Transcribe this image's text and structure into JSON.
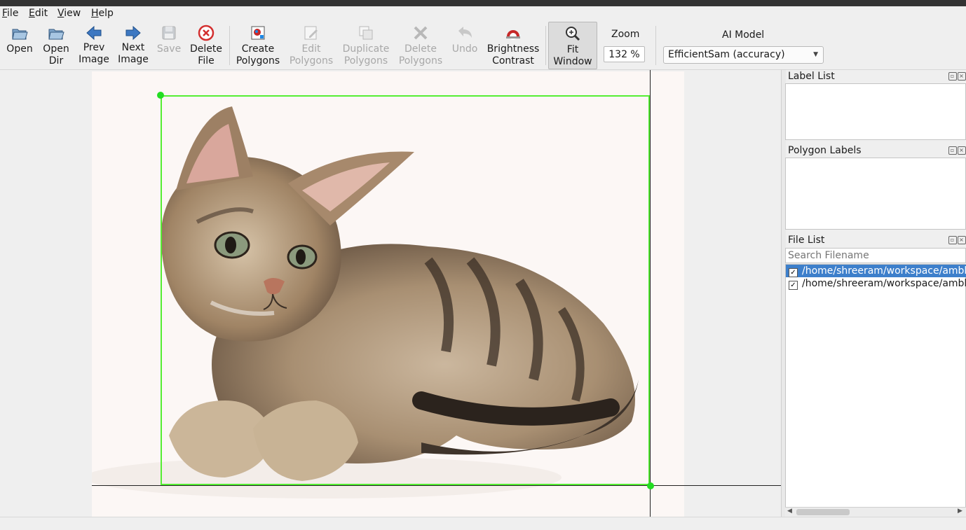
{
  "menu": [
    {
      "label": "File"
    },
    {
      "label": "Edit"
    },
    {
      "label": "View"
    },
    {
      "label": "Help"
    }
  ],
  "toolbar": {
    "open": "Open",
    "open_dir": "Open\nDir",
    "prev_image": "Prev\nImage",
    "next_image": "Next\nImage",
    "save": "Save",
    "delete_file": "Delete\nFile",
    "create_polygons": "Create\nPolygons",
    "edit_polygons": "Edit\nPolygons",
    "duplicate_polygons": "Duplicate\nPolygons",
    "delete_polygons": "Delete\nPolygons",
    "undo": "Undo",
    "brightness_contrast": "Brightness\nContrast",
    "fit_window": "Fit\nWindow"
  },
  "zoom": {
    "label": "Zoom",
    "value": "132 %"
  },
  "ai_model": {
    "label": "AI Model",
    "selected": "EfficientSam (accuracy)"
  },
  "docks": {
    "label_list": {
      "title": "Label List"
    },
    "polygon_labels": {
      "title": "Polygon Labels"
    },
    "file_list": {
      "title": "File List",
      "search_placeholder": "Search Filename",
      "files": [
        {
          "path": "/home/shreeram/workspace/ambl/",
          "checked": true,
          "selected": true
        },
        {
          "path": "/home/shreeram/workspace/ambl/",
          "checked": true,
          "selected": false
        }
      ]
    }
  },
  "colors": {
    "selection": "#3d7fcb",
    "bbox": "#55ee33",
    "accent_red": "#d32f2f"
  }
}
